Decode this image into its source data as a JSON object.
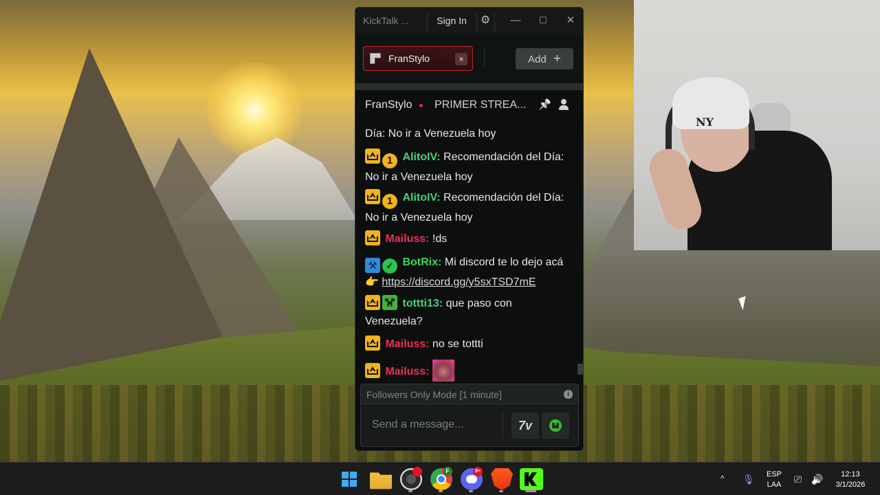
{
  "window": {
    "title": "KickTalk ...",
    "sign_in": "Sign In",
    "icons": [
      "gear-icon",
      "minimize-icon",
      "maximize-icon",
      "close-icon"
    ],
    "minimize_glyph": "—",
    "maximize_glyph": "☐",
    "close_glyph": "✕",
    "gear_glyph": "⚙"
  },
  "tabs": [
    {
      "label": "FranStylo",
      "active": true,
      "close_glyph": "×"
    }
  ],
  "add_button": {
    "label": "Add",
    "plus": "+"
  },
  "channel_header": {
    "name": "FranStylo",
    "live": true,
    "stream_title": "PRIMER STREA...",
    "pin_glyph": "📌"
  },
  "messages": [
    {
      "username": "",
      "text": "Día: No ir a Venezuela hoy",
      "badges": []
    },
    {
      "username": "AlitoIV:",
      "color": "green",
      "text": "Recomendación del Día: No ir a Venezuela hoy",
      "badges": [
        "crown",
        "subscriber-1"
      ],
      "badge_one": "1"
    },
    {
      "username": "AlitoIV:",
      "color": "green",
      "text": "Recomendación del Día: No ir a Venezuela hoy",
      "badges": [
        "crown",
        "subscriber-1"
      ],
      "badge_one": "1"
    },
    {
      "username": "Mailuss:",
      "color": "red",
      "text": "!ds",
      "badges": [
        "crown"
      ]
    },
    {
      "username": "BotRix:",
      "color": "lime",
      "text": "Mi discord te lo dejo acá",
      "emoji": "👉",
      "link": "https://discord.gg/y5sxTSD7mE",
      "badges": [
        "bot",
        "verified"
      ],
      "bot_glyph": "⚒",
      "verified_glyph": "✓"
    },
    {
      "username": "tottti13:",
      "color": "green",
      "text": "que paso con Venezuela?",
      "badges": [
        "crown",
        "creeper"
      ]
    },
    {
      "username": "Mailuss:",
      "color": "red",
      "text": "no se tottti",
      "badges": [
        "crown"
      ]
    },
    {
      "username": "Mailuss:",
      "color": "red",
      "text": "",
      "emote": true,
      "badges": [
        "crown"
      ]
    }
  ],
  "chat_input": {
    "mode_notice": "Followers Only Mode [1 minute]",
    "info_glyph": "i",
    "placeholder": "Send a message...",
    "emote_button_1": "7TV",
    "emote_button_1_glyph": "7v"
  },
  "taskbar": {
    "apps": [
      "windows-start",
      "file-explorer",
      "obs-studio",
      "chrome",
      "discord",
      "brave",
      "kick"
    ],
    "chrome_badge": "F",
    "discord_badge": "9+",
    "language_top": "ESP",
    "language_bottom": "LAA",
    "time": "12:13",
    "date": "3/1/2026",
    "tray_icons": [
      "chevron-up-icon",
      "microphone-icon",
      "network-icon",
      "volume-icon"
    ],
    "chevron_glyph": "^",
    "mic_glyph": "🎙",
    "net_glyph": "⎚",
    "vol_glyph": "🔊"
  },
  "webcam": {
    "hat_logo": "NY"
  },
  "colors": {
    "accent_red": "#c2262e",
    "username_green": "#49d07c",
    "username_red": "#ef2f57",
    "username_lime": "#3ed552",
    "badge_gold": "#f2b41a",
    "kick_green": "#53fc18"
  }
}
